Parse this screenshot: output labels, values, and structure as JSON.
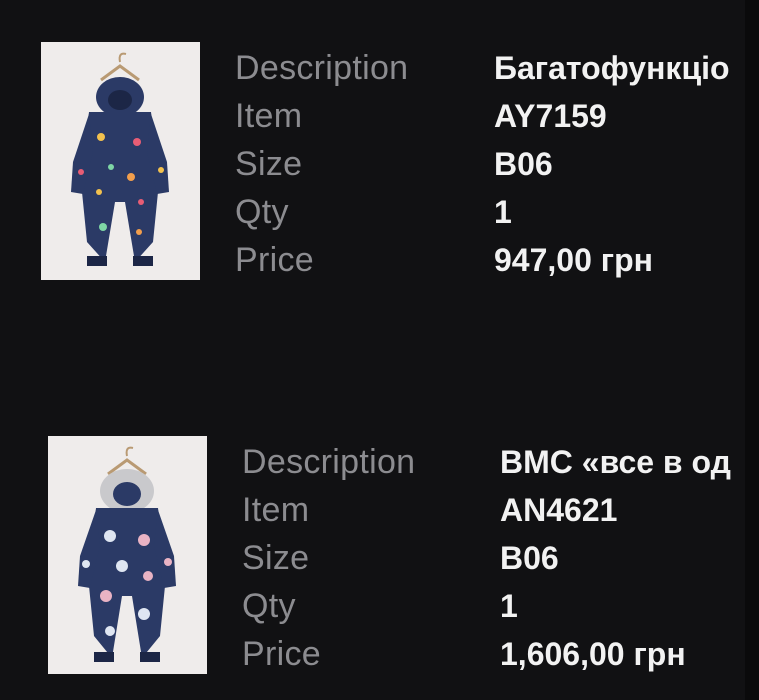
{
  "order_items": [
    {
      "labels": {
        "description": "Description",
        "item": "Item",
        "size": "Size",
        "qty": "Qty",
        "price": "Price"
      },
      "values": {
        "description": "Багатофункціо",
        "item": "AY7159",
        "size": "B06",
        "qty": "1",
        "price": "947,00 грн"
      },
      "image_icon": "navy-snowsuit-image"
    },
    {
      "labels": {
        "description": "Description",
        "item": "Item",
        "size": "Size",
        "qty": "Qty",
        "price": "Price"
      },
      "values": {
        "description": "ВМС «все в од",
        "item": "AN4621",
        "size": "B06",
        "qty": "1",
        "price": "1,606,00 грн"
      },
      "image_icon": "floral-snowsuit-image"
    }
  ],
  "colors": {
    "background": "#111113",
    "label_text": "#8c8c90",
    "value_text": "#f2f2f2",
    "snowsuit_navy": "#2b3a66"
  }
}
